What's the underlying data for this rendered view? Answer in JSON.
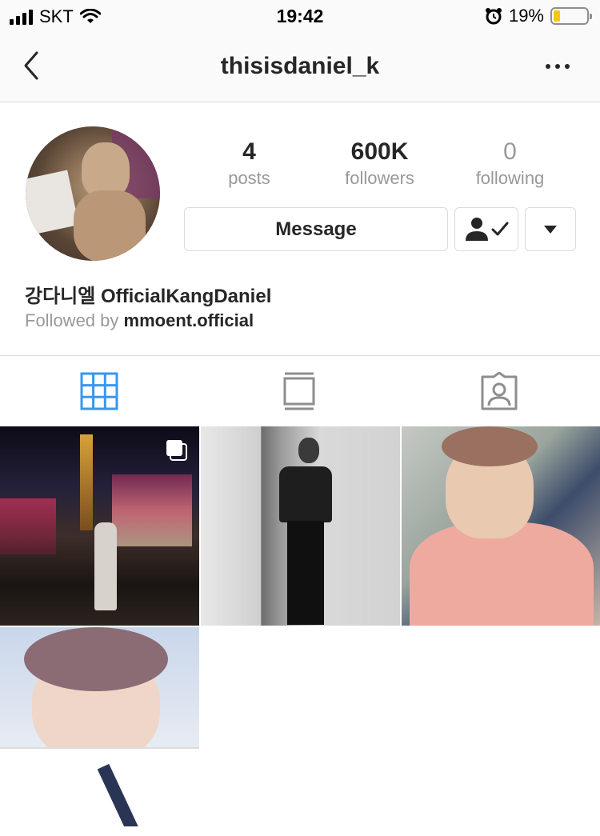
{
  "status_bar": {
    "carrier": "SKT",
    "time": "19:42",
    "battery_percent": "19%",
    "battery_level": 0.19,
    "battery_color": "#f5c518"
  },
  "nav": {
    "title": "thisisdaniel_k",
    "back_icon": "chevron-left-icon",
    "more_icon": "more-horizontal-icon"
  },
  "profile": {
    "avatar_icon": "profile-avatar",
    "stats": [
      {
        "value": "4",
        "label": "posts"
      },
      {
        "value": "600K",
        "label": "followers"
      },
      {
        "value": "0",
        "label": "following"
      }
    ],
    "message_label": "Message",
    "following_icon": "person-check-icon",
    "dropdown_icon": "caret-down-icon",
    "name": "강다니엘 OfficialKangDaniel",
    "followed_by_prefix": "Followed by",
    "followed_by_user": "mmoent.official"
  },
  "tabs": {
    "items": [
      {
        "icon": "grid-icon",
        "active": true
      },
      {
        "icon": "feed-icon",
        "active": false
      },
      {
        "icon": "tagged-icon",
        "active": false
      }
    ],
    "active_color": "#3897f0"
  },
  "posts": {
    "count": 4,
    "multi_icon": "multiple-photos-icon"
  }
}
